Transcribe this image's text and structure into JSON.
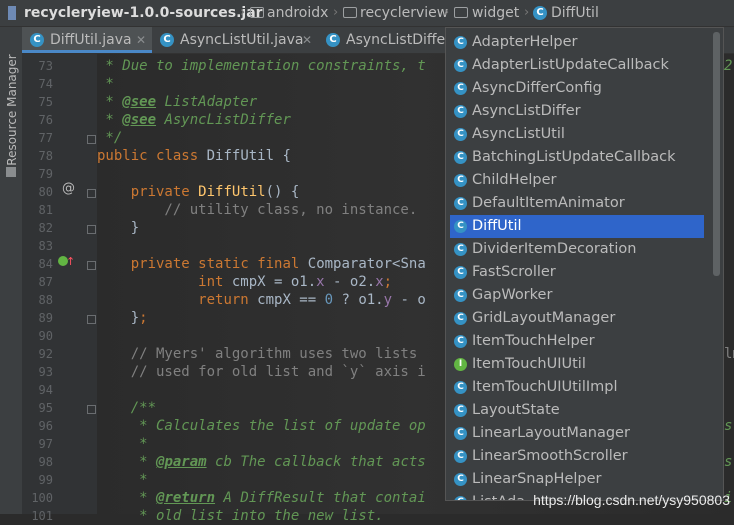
{
  "breadcrumb": {
    "jar": "recycleryiew-1.0.0-sources.jar",
    "items": [
      "androidx",
      "recyclerview",
      "widget",
      "DiffUtil"
    ]
  },
  "sidebar": {
    "label": "Resource Manager"
  },
  "tabs": [
    {
      "label": "DiffUtil.java",
      "active": true
    },
    {
      "label": "AsyncListUtil.java",
      "active": false
    },
    {
      "label": "AsyncListDiffer.",
      "active": false
    }
  ],
  "editor": {
    "line_numbers": [
      "73",
      "74",
      "75",
      "76",
      "77",
      "78",
      "79",
      "80",
      "81",
      "82",
      "83",
      "84",
      "87",
      "88",
      "89",
      "90",
      "92",
      "93",
      "94",
      "95",
      "96",
      "97",
      "98",
      "99",
      "100",
      "101"
    ],
    "lines": [
      " * Due to implementation constraints, t",
      " *",
      " * @see ListAdapter",
      " * @see AsyncListDiffer",
      " */",
      "public class DiffUtil {",
      "",
      "    private DiffUtil() {",
      "        // utility class, no instance.",
      "    }",
      "",
      "    private static final Comparator<Sna",
      "            int cmpX = o1.x - o2.x;",
      "            return cmpX == 0 ? o1.y - o",
      "    };",
      "",
      "    // Myers' algorithm uses two lists",
      "    // used for old list and `y` axis i",
      "",
      "    /**",
      "     * Calculates the list of update op",
      "     *",
      "     * @param cb The callback that acts",
      "     *",
      "     * @return A DiffResult that contai",
      "     * old list into the new list."
    ],
    "right_fragments": {
      "l73": "2",
      "l92": "lm",
      "l96": "s",
      "l98": "s",
      "l100": "i"
    }
  },
  "popup": {
    "items": [
      {
        "label": "AdapterHelper",
        "kind": "class"
      },
      {
        "label": "AdapterListUpdateCallback",
        "kind": "class"
      },
      {
        "label": "AsyncDifferConfig",
        "kind": "class"
      },
      {
        "label": "AsyncListDiffer",
        "kind": "class"
      },
      {
        "label": "AsyncListUtil",
        "kind": "class"
      },
      {
        "label": "BatchingListUpdateCallback",
        "kind": "class"
      },
      {
        "label": "ChildHelper",
        "kind": "class"
      },
      {
        "label": "DefaultItemAnimator",
        "kind": "class"
      },
      {
        "label": "DiffUtil",
        "kind": "class",
        "selected": true
      },
      {
        "label": "DividerItemDecoration",
        "kind": "class"
      },
      {
        "label": "FastScroller",
        "kind": "class"
      },
      {
        "label": "GapWorker",
        "kind": "class"
      },
      {
        "label": "GridLayoutManager",
        "kind": "class"
      },
      {
        "label": "ItemTouchHelper",
        "kind": "class"
      },
      {
        "label": "ItemTouchUIUtil",
        "kind": "interface"
      },
      {
        "label": "ItemTouchUIUtilImpl",
        "kind": "class"
      },
      {
        "label": "LayoutState",
        "kind": "class"
      },
      {
        "label": "LinearLayoutManager",
        "kind": "class"
      },
      {
        "label": "LinearSmoothScroller",
        "kind": "class"
      },
      {
        "label": "LinearSnapHelper",
        "kind": "class"
      },
      {
        "label": "ListAda",
        "kind": "class"
      }
    ]
  },
  "watermark": "https://blog.csdn.net/ysy950803",
  "colors": {
    "selection": "#2f65ca",
    "class_icon": "#3592c4",
    "interface_icon": "#62b543"
  }
}
